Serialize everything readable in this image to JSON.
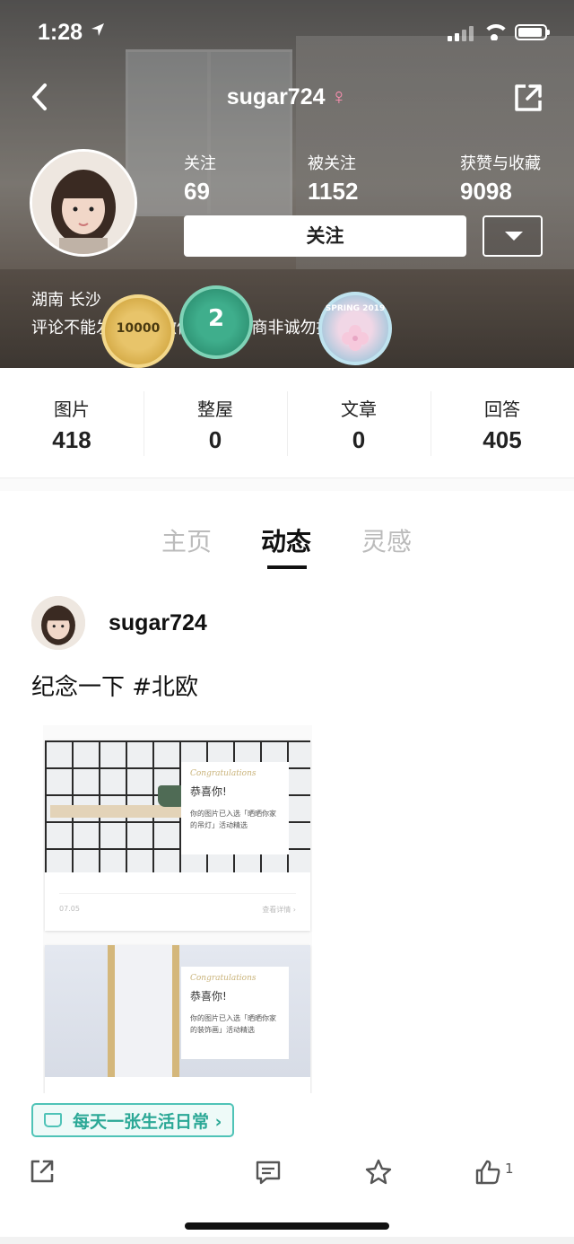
{
  "status_bar": {
    "time": "1:28",
    "location_arrow": "location-arrow-icon"
  },
  "profile": {
    "username": "sugar724",
    "gender_symbol": "♀",
    "stats_top": [
      {
        "label": "关注",
        "value": "69"
      },
      {
        "label": "被关注",
        "value": "1152"
      },
      {
        "label": "获赞与收藏",
        "value": "9098"
      }
    ],
    "follow_button": "关注",
    "location": "湖南 长沙",
    "bio": "评论不能发的请加微信.  不是微商非诚勿扰",
    "badges": [
      {
        "name": "times-badge",
        "label": "10000"
      },
      {
        "name": "two-years-badge",
        "label": "2"
      },
      {
        "name": "spring-2019-badge",
        "label": "SPRING 2019"
      }
    ]
  },
  "content_stats": [
    {
      "label": "图片",
      "value": "418"
    },
    {
      "label": "整屋",
      "value": "0"
    },
    {
      "label": "文章",
      "value": "0"
    },
    {
      "label": "回答",
      "value": "405"
    }
  ],
  "tabs": [
    {
      "label": "主页",
      "active": false
    },
    {
      "label": "动态",
      "active": true
    },
    {
      "label": "灵感",
      "active": false
    }
  ],
  "post": {
    "author": "sugar724",
    "text": "纪念一下 #北欧",
    "cards": [
      {
        "cursive": "Congratulations",
        "headline": "恭喜你!",
        "body": "你的图片已入选「晒晒你家的吊灯」活动精选",
        "date": "07.05",
        "details": "查看详情 ›"
      },
      {
        "cursive": "Congratulations",
        "headline": "恭喜你!",
        "body": "你的图片已入选「晒晒你家的装饰画」活动精选"
      }
    ],
    "tag": "每天一张生活日常 ›"
  },
  "toolbar": {
    "like_count": "1"
  },
  "colors": {
    "accent_teal": "#4fc3b7",
    "gender_pink": "#ff8fb2"
  }
}
